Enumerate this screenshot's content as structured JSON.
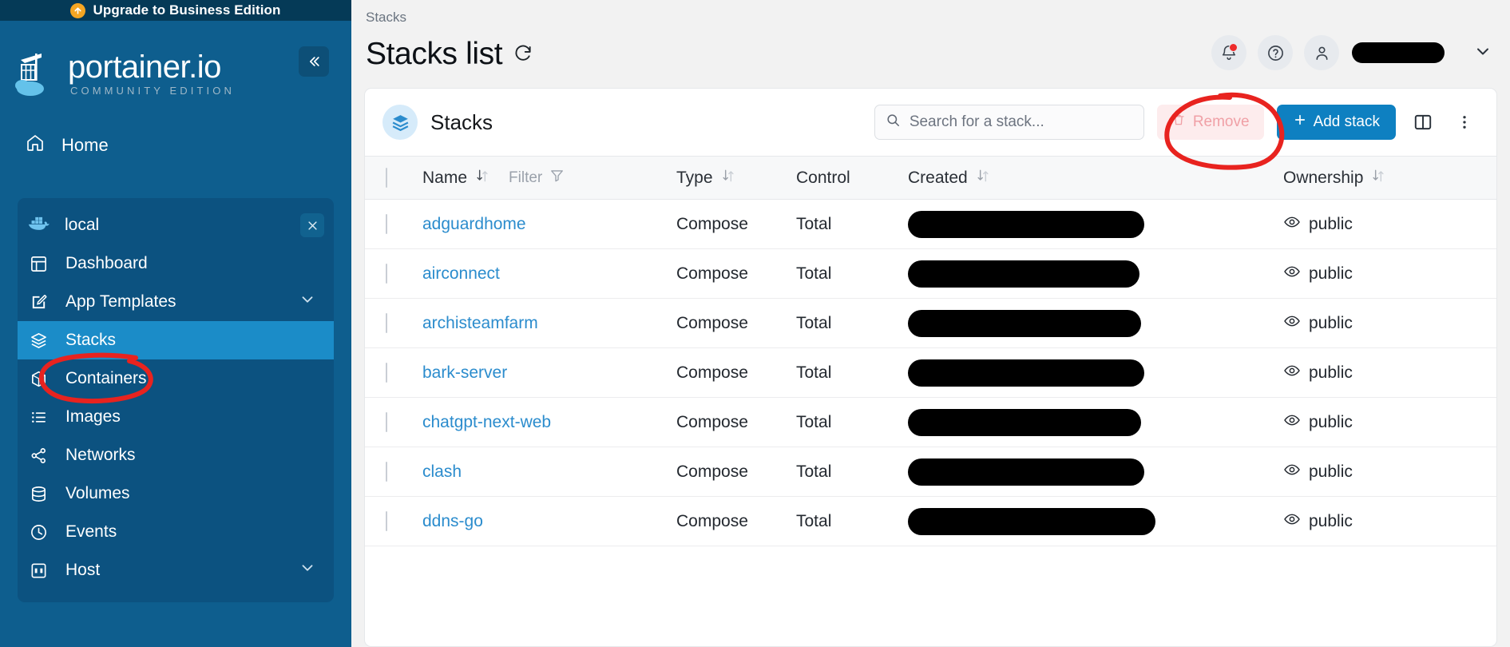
{
  "banner": {
    "text": "Upgrade to Business Edition",
    "icon": "arrow-up-circle-icon",
    "color": "#f5a623"
  },
  "brand": {
    "title": "portainer.io",
    "subtitle": "COMMUNITY EDITION"
  },
  "sidebar": {
    "collapse_icon": "chevron-double-left-icon",
    "home": {
      "label": "Home",
      "icon": "home-icon"
    },
    "environment": {
      "label": "local",
      "icon": "docker-icon",
      "close_icon": "close-icon"
    },
    "items": [
      {
        "label": "Dashboard",
        "icon": "dashboard-icon",
        "active": false,
        "chevron": false
      },
      {
        "label": "App Templates",
        "icon": "edit-square-icon",
        "active": false,
        "chevron": true
      },
      {
        "label": "Stacks",
        "icon": "layers-icon",
        "active": true,
        "chevron": false
      },
      {
        "label": "Containers",
        "icon": "box-icon",
        "active": false,
        "chevron": false
      },
      {
        "label": "Images",
        "icon": "list-icon",
        "active": false,
        "chevron": false
      },
      {
        "label": "Networks",
        "icon": "share-nodes-icon",
        "active": false,
        "chevron": false
      },
      {
        "label": "Volumes",
        "icon": "database-icon",
        "active": false,
        "chevron": false
      },
      {
        "label": "Events",
        "icon": "clock-icon",
        "active": false,
        "chevron": false
      },
      {
        "label": "Host",
        "icon": "server-icon",
        "active": false,
        "chevron": true
      }
    ],
    "active_color": "#1b8cc8"
  },
  "header": {
    "breadcrumb": "Stacks",
    "page_title": "Stacks list",
    "refresh_icon": "refresh-icon",
    "notification_icon": "bell-icon",
    "notification_badge_color": "#ee2b2b",
    "help_icon": "question-circle-icon",
    "avatar_icon": "user-icon",
    "user_name": "",
    "caret_icon": "chevron-down-icon"
  },
  "card": {
    "title": "Stacks",
    "title_icon": "layers-icon",
    "search": {
      "placeholder": "Search for a stack...",
      "value": "",
      "icon": "search-icon"
    },
    "remove_button": {
      "label": "Remove",
      "icon": "trash-icon",
      "disabled": true
    },
    "add_button": {
      "label": "Add stack",
      "icon": "plus-icon",
      "color": "#0e80c1"
    },
    "columns_icon": "columns-layout-icon",
    "menu_icon": "kebab-menu-icon"
  },
  "table": {
    "columns": [
      {
        "key": "name",
        "label": "Name",
        "sortable": true
      },
      {
        "key": "filter",
        "label": "Filter",
        "icon": "funnel-icon"
      },
      {
        "key": "type",
        "label": "Type",
        "sortable": true
      },
      {
        "key": "control",
        "label": "Control",
        "sortable": false
      },
      {
        "key": "created",
        "label": "Created",
        "sortable": true
      },
      {
        "key": "ownership",
        "label": "Ownership",
        "sortable": true
      }
    ],
    "rows": [
      {
        "name": "adguardhome",
        "type": "Compose",
        "control": "Total",
        "created": "[redacted]",
        "created_width": 296,
        "ownership": "public",
        "ownership_icon": "eye-icon"
      },
      {
        "name": "airconnect",
        "type": "Compose",
        "control": "Total",
        "created": "[redacted]",
        "created_width": 290,
        "ownership": "public",
        "ownership_icon": "eye-icon"
      },
      {
        "name": "archisteamfarm",
        "type": "Compose",
        "control": "Total",
        "created": "[redacted]",
        "created_width": 292,
        "ownership": "public",
        "ownership_icon": "eye-icon"
      },
      {
        "name": "bark-server",
        "type": "Compose",
        "control": "Total",
        "created": "[redacted]",
        "created_width": 296,
        "ownership": "public",
        "ownership_icon": "eye-icon"
      },
      {
        "name": "chatgpt-next-web",
        "type": "Compose",
        "control": "Total",
        "created": "[redacted]",
        "created_width": 292,
        "ownership": "public",
        "ownership_icon": "eye-icon"
      },
      {
        "name": "clash",
        "type": "Compose",
        "control": "Total",
        "created": "[redacted]",
        "created_width": 296,
        "ownership": "public",
        "ownership_icon": "eye-icon"
      },
      {
        "name": "ddns-go",
        "type": "Compose",
        "control": "Total",
        "created": "[redacted]",
        "created_width": 310,
        "ownership": "public",
        "ownership_icon": "eye-icon"
      }
    ]
  },
  "annotations": {
    "color": "#e8231f",
    "targets": [
      "sidebar-item-stacks",
      "add-stack-button"
    ]
  }
}
